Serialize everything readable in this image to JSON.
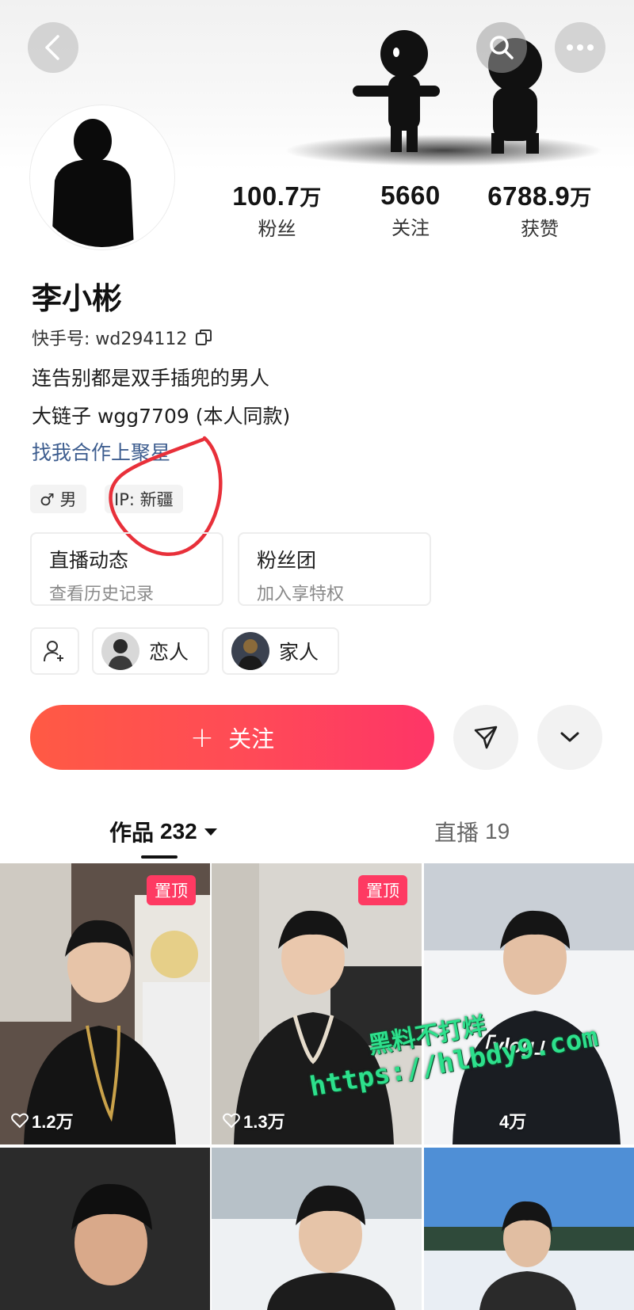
{
  "header": {
    "back_icon": "chevron-left-icon",
    "search_icon": "search-icon",
    "more_icon": "more-horizontal-icon"
  },
  "stats": {
    "fans": {
      "value": "100.7",
      "unit": "万",
      "label": "粉丝"
    },
    "following": {
      "value": "5660",
      "unit": "",
      "label": "关注"
    },
    "likes": {
      "value": "6788.9",
      "unit": "万",
      "label": "获赞"
    }
  },
  "profile": {
    "name": "李小彬",
    "kuaishou_id": "快手号: wd294112",
    "bio_line1": "连告别都是双手插兜的男人",
    "bio_line2": "大链子 wgg7709 (本人同款)",
    "collab_link": "找我合作上聚星",
    "gender_tag": "♂ 男",
    "ip_tag": "IP: 新疆"
  },
  "cards": {
    "live": {
      "title": "直播动态",
      "subtitle": "查看历史记录"
    },
    "fan_club": {
      "title": "粉丝团",
      "subtitle": "加入享特权"
    }
  },
  "relations": {
    "lover": "恋人",
    "family": "家人"
  },
  "actions": {
    "follow_label": "关注",
    "accent": "#fe3a62"
  },
  "tabs": {
    "works_label": "作品",
    "works_count": "232",
    "live_label": "直播",
    "live_count": "19"
  },
  "grid": {
    "pinned_label": "置顶",
    "item1_likes": "1.2万",
    "item2_likes": "1.3万",
    "item3_likes": "4万",
    "item3_caption": "「vlog」"
  },
  "watermark": {
    "line1": "黑料不打烊",
    "line2": "https://hlbdy9.com"
  }
}
